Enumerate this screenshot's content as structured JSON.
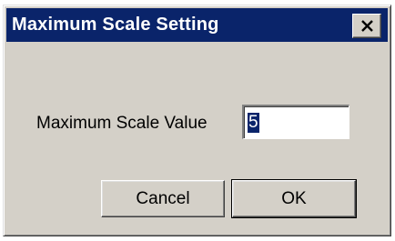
{
  "dialog": {
    "title": "Maximum Scale Setting",
    "close_icon": "close-icon"
  },
  "form": {
    "label": "Maximum Scale Value",
    "value": "5"
  },
  "buttons": {
    "cancel_label": "Cancel",
    "ok_label": "OK"
  },
  "colors": {
    "titlebar": "#0a246a",
    "face": "#d4d0c8"
  }
}
